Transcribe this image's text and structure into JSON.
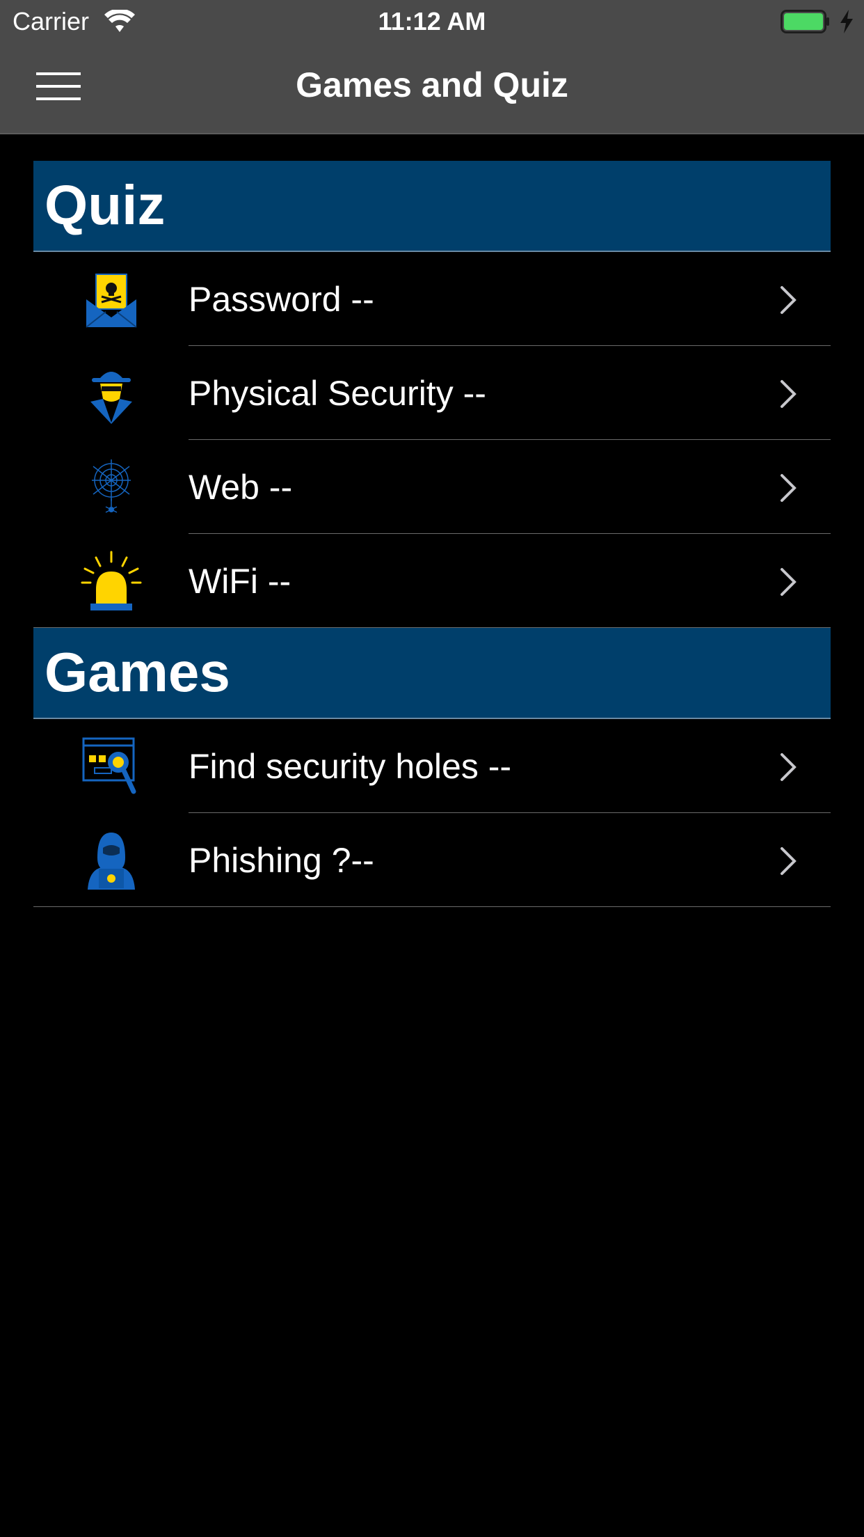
{
  "status_bar": {
    "carrier": "Carrier",
    "time": "11:12 AM",
    "icons": [
      "wifi-icon",
      "battery-icon",
      "charging-bolt-icon"
    ],
    "battery_color": "#4cd964"
  },
  "nav": {
    "title": "Games and Quiz",
    "menu_icon": "hamburger-menu-icon"
  },
  "colors": {
    "section_header_bg": "#003f6b",
    "nav_bg": "#4a4a4a",
    "icon_blue": "#1565c0",
    "icon_yellow": "#ffd400"
  },
  "sections": [
    {
      "title": "Quiz",
      "items": [
        {
          "label": "Password --",
          "icon": "envelope-skull-icon"
        },
        {
          "label": "Physical Security --",
          "icon": "spy-hat-icon"
        },
        {
          "label": "Web --",
          "icon": "spider-web-icon"
        },
        {
          "label": "WiFi --",
          "icon": "alarm-siren-icon"
        }
      ]
    },
    {
      "title": "Games",
      "items": [
        {
          "label": "Find security holes --",
          "icon": "magnifier-browser-icon"
        },
        {
          "label": "Phishing ?--",
          "icon": "hooded-hacker-icon"
        }
      ]
    }
  ]
}
